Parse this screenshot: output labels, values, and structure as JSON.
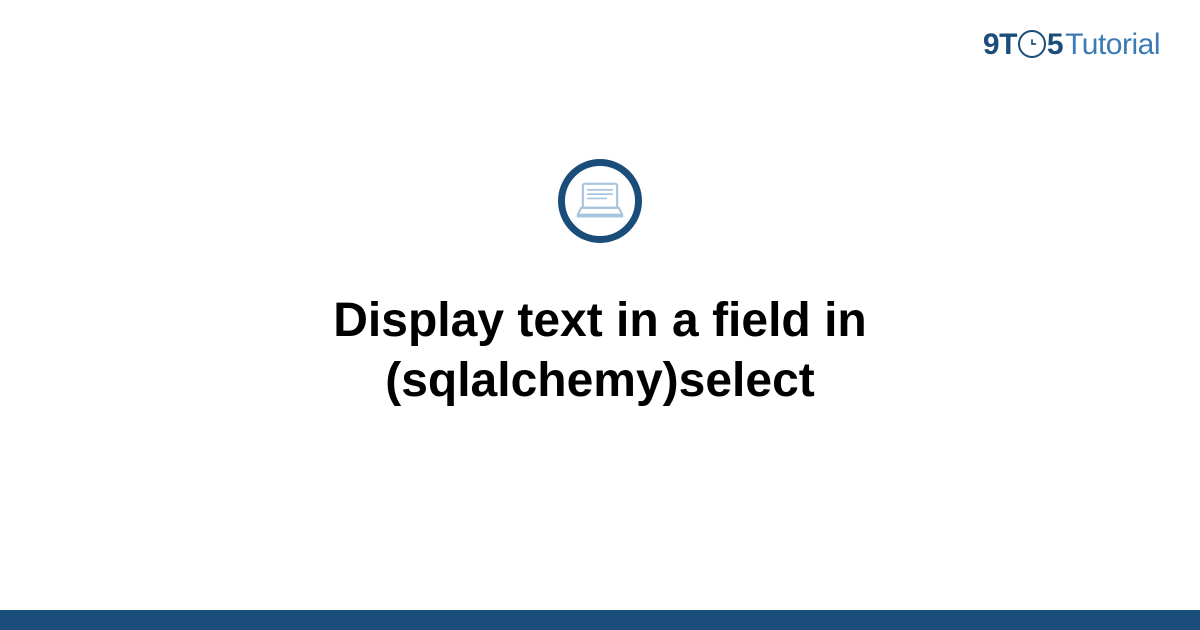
{
  "logo": {
    "nine": "9",
    "t": "T",
    "five": "5",
    "tutorial": "Tutorial"
  },
  "title": "Display text in a field in (sqlalchemy)select",
  "icon": "laptop-icon",
  "colors": {
    "brand_dark": "#1a4d7a",
    "brand_light": "#3b7bb5",
    "icon_fill": "#a8c5e0"
  }
}
